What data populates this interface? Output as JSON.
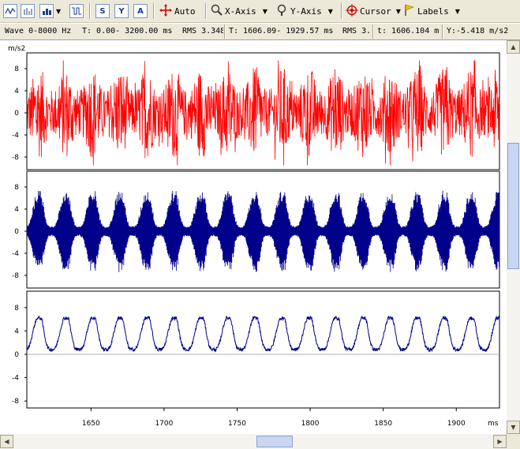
{
  "toolbar": {
    "auto_label": "Auto",
    "xaxis_label": "X-Axis",
    "yaxis_label": "Y-Axis",
    "cursor_label": "Cursor",
    "labels_label": "Labels",
    "icons": [
      "wave-icon",
      "spectrum-icon",
      "bar-icon",
      "filter-icon",
      "s-icon",
      "y-icon",
      "a-icon",
      "crosshair-icon",
      "zoom-icon",
      "zoom-y-icon",
      "cursor-icon",
      "flag-icon"
    ],
    "icon_glyphs": {
      "s": "S",
      "y": "Y",
      "a": "A"
    }
  },
  "status": {
    "wave": "Wave 0-8000 Hz",
    "time_range": "T: 0.00- 3200.00 ms",
    "rms1": "RMS 3.348",
    "t_range2": "T: 1606.09- 1929.57 ms",
    "rms2": "RMS 3.",
    "cursor_t": "t: 1606.104 m",
    "cursor_y": "Y:-5.418 m/s2"
  },
  "plot": {
    "y_unit": "m/s2",
    "x_unit": "ms",
    "colors": {
      "panel1": "#ff0000",
      "panel2": "#00008b",
      "panel3": "#00008b",
      "zero_line": "#999999"
    }
  },
  "chart_data": [
    {
      "type": "line",
      "series": [
        {
          "name": "",
          "color": "#ff0000",
          "style": "noise",
          "envelope_peak": 8,
          "burst_period_ms": 18.5
        }
      ],
      "x_range": [
        1606.09,
        1929.57
      ],
      "ylim": [
        -10,
        10
      ],
      "yticks": [
        8,
        4,
        0,
        -4,
        -8
      ],
      "ylabel": "m/s2"
    },
    {
      "type": "line",
      "series": [
        {
          "name": "",
          "color": "#00008b",
          "style": "bursts",
          "envelope_peak": 6.5,
          "burst_period_ms": 18.5
        }
      ],
      "x_range": [
        1606.09,
        1929.57
      ],
      "ylim": [
        -10,
        10
      ],
      "yticks": [
        8,
        4,
        0,
        -4,
        -8
      ]
    },
    {
      "type": "line",
      "series": [
        {
          "name": "",
          "color": "#00008b",
          "style": "envelope",
          "peak": 6.2,
          "burst_period_ms": 18.5
        }
      ],
      "x_range": [
        1606.09,
        1929.57
      ],
      "ylim": [
        -10,
        10
      ],
      "yticks": [
        8,
        4,
        0,
        -4,
        -8
      ],
      "xticks": [
        1650,
        1700,
        1750,
        1800,
        1850,
        1900
      ],
      "xlabel": "ms"
    }
  ]
}
